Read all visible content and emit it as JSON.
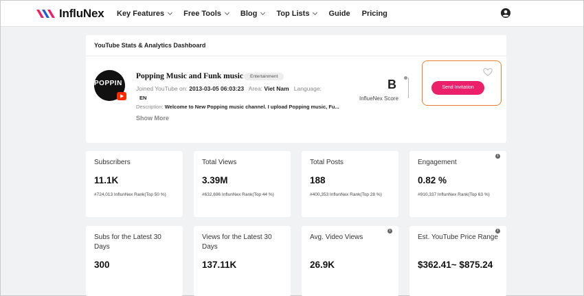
{
  "brand": {
    "name": "InfluNex"
  },
  "nav": {
    "items": [
      {
        "label": "Key Features",
        "dropdown": true
      },
      {
        "label": "Free Tools",
        "dropdown": true
      },
      {
        "label": "Blog",
        "dropdown": true
      },
      {
        "label": "Top Lists",
        "dropdown": true
      },
      {
        "label": "Guide",
        "dropdown": false
      },
      {
        "label": "Pricing",
        "dropdown": false
      }
    ],
    "user_icon": "account-circle-icon"
  },
  "dashboard": {
    "title": "YouTube Stats & Analytics Dashboard",
    "channel": {
      "avatar_text": "POPPIN",
      "name": "Popping Music and Funk music",
      "category": "Entertainment",
      "joined_label": "Joined YouTube on:",
      "joined_value": "2013-03-05 06:03:23",
      "area_label": "Area:",
      "area_value": "Viet Nam",
      "language_label": "Language:",
      "language_value": "EN",
      "description_label": "Description:",
      "description_value": "Welcome to New Popping music channel. I upload Popping music, Fu...",
      "show_more": "Show More"
    },
    "score": {
      "grade": "B",
      "label": "InflueNex Score"
    },
    "cta": {
      "button": "Send Invitation",
      "favorite_icon": "heart-outline-icon"
    }
  },
  "stats": [
    {
      "label": "Subscribers",
      "value": "11.1K",
      "rank": "#724,013 InflunNex Rank(Top 50 %)",
      "info": false
    },
    {
      "label": "Total Views",
      "value": "3.39M",
      "rank": "#632,696 InflunNex Rank(Top 44 %)",
      "info": false
    },
    {
      "label": "Total Posts",
      "value": "188",
      "rank": "#400,353 InflunNex Rank(Top 28 %)",
      "info": false
    },
    {
      "label": "Engagement",
      "value": "0.82 %",
      "rank": "#910,337 InflunNex Rank(Top 63 %)",
      "info": true
    },
    {
      "label": "Subs for the Latest 30 Days",
      "value": "300",
      "info": false
    },
    {
      "label": "Views for the Latest 30 Days",
      "value": "137.11K",
      "info": false
    },
    {
      "label": "Avg. Video Views",
      "value": "26.9K",
      "info": true
    },
    {
      "label": "Est. YouTube Price Range",
      "value": "$362.41~ $875.24",
      "info": true
    }
  ],
  "colors": {
    "accent_pink": "#ec1f6b",
    "cta_border": "#ef7d2e",
    "youtube_red": "#ff2a00"
  }
}
